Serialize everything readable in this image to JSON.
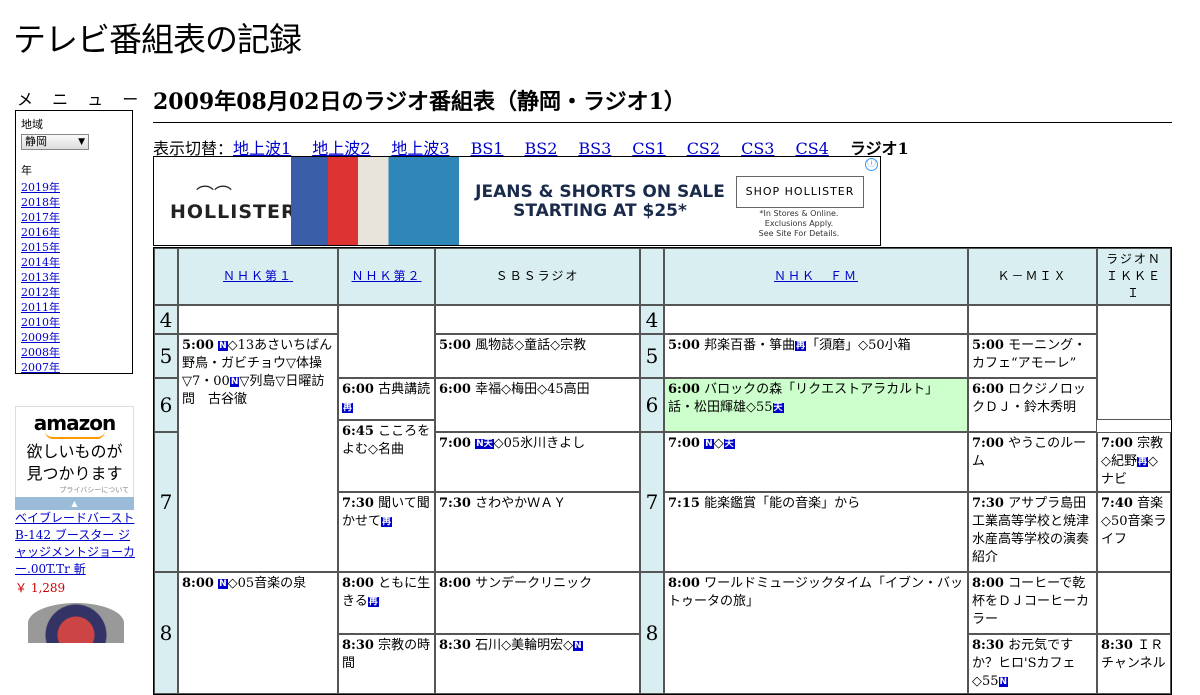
{
  "site": {
    "title": "テレビ番組表の記録"
  },
  "menu": {
    "heading": "メ ニ ュ ー",
    "region_label": "地域",
    "region_value": "静岡",
    "year_label": "年",
    "years": [
      "2019年",
      "2018年",
      "2017年",
      "2016年",
      "2015年",
      "2014年",
      "2013年",
      "2012年",
      "2011年",
      "2010年",
      "2009年",
      "2008年",
      "2007年"
    ]
  },
  "sidebar_ad": {
    "brand": "amazon",
    "message_line1": "欲しいものが",
    "message_line2": "見つかります",
    "privacy": "プライバシーについて",
    "product_title": "ベイブレードバースト B-142 ブースター ジャッジメントジョーカー.00T.Tr 斬",
    "product_price": "￥ 1,289"
  },
  "page": {
    "title": "2009年08月02日のラジオ番組表（静岡・ラジオ1）",
    "switch_label": "表示切替：",
    "switch_links": [
      "地上波1",
      "地上波2",
      "地上波3",
      "BS1",
      "BS2",
      "BS3",
      "CS1",
      "CS2",
      "CS3",
      "CS4"
    ],
    "switch_current": "ラジオ1"
  },
  "banner_ad": {
    "brand": "HOLLISTER",
    "headline_line1": "JEANS & SHORTS ON SALE",
    "headline_line2": "STARTING AT $25*",
    "button": "SHOP HOLLISTER",
    "fine1": "*In Stores & Online.",
    "fine2": "Exclusions Apply.",
    "fine3": "See Site For Details.",
    "info": "ⓘ"
  },
  "schedule": {
    "channels": [
      "ＮＨＫ第１",
      "ＮＨＫ第２",
      "ＳＢＳラジオ",
      "ＮＨＫ　ＦＭ",
      "Ｋ－ＭＩＸ",
      "ラジオＮＩＫＫＥＩ"
    ],
    "hours": [
      "4",
      "5",
      "6",
      "7",
      "8"
    ],
    "programs": {
      "nhk1_500": {
        "time": "5:00",
        "badge": "N",
        "text": "◇13あさいちばん　野鳥・ガビチョウ▽体操▽7・00",
        "badge2": "N",
        "text2": "▽列島▽日曜訪問　古谷徹"
      },
      "nhk1_800": {
        "time": "8:00",
        "badge": "N",
        "text": "◇05音楽の泉"
      },
      "nhk2_600": {
        "time": "6:00",
        "text": "古典講読",
        "badge": "再"
      },
      "nhk2_645": {
        "time": "6:45",
        "text": "こころをよむ◇名曲"
      },
      "nhk2_730": {
        "time": "7:30",
        "text": "聞いて聞かせて",
        "badge": "再"
      },
      "nhk2_800": {
        "time": "8:00",
        "text": "ともに生きる",
        "badge": "再"
      },
      "nhk2_830": {
        "time": "8:30",
        "text": "宗教の時間"
      },
      "sbs_500": {
        "time": "5:00",
        "text": "風物誌◇童話◇宗教"
      },
      "sbs_600": {
        "time": "6:00",
        "text": "幸福◇梅田◇45高田"
      },
      "sbs_700": {
        "time": "7:00",
        "badge": "N天",
        "text": "◇05氷川きよし"
      },
      "sbs_730": {
        "time": "7:30",
        "text": "さわやかＷＡＹ"
      },
      "sbs_800": {
        "time": "8:00",
        "text": "サンデークリニック"
      },
      "sbs_830": {
        "time": "8:30",
        "text": "石川◇美輪明宏◇",
        "badge": "N"
      },
      "fm_500": {
        "time": "5:00",
        "text": "邦楽百番・箏曲",
        "badge": "再",
        "text2": "「須磨」◇50小箱"
      },
      "fm_600": {
        "time": "6:00",
        "text": "バロックの森「リクエストアラカルト」話・松田輝雄◇55",
        "badge": "天"
      },
      "fm_700": {
        "time": "7:00",
        "badge": "N",
        "text": "◇",
        "badge2": "天"
      },
      "fm_715": {
        "time": "7:15",
        "text": "能楽鑑賞「能の音楽」から"
      },
      "fm_800": {
        "time": "8:00",
        "text": "ワールドミュージックタイム「イブン・バットゥータの旅」"
      },
      "kmix_500": {
        "time": "5:00",
        "text": "モーニング・カフェ“アモーレ”"
      },
      "kmix_600": {
        "time": "6:00",
        "text": "ロクジノロックＤＪ・鈴木秀明"
      },
      "kmix_700": {
        "time": "7:00",
        "text": "やうこのルーム"
      },
      "kmix_730": {
        "time": "7:30",
        "text": "アサプラ島田工業高等学校と焼津水産高等学校の演奏紹介"
      },
      "kmix_800": {
        "time": "8:00",
        "text": "コーヒーで乾杯をＤＪコーヒーカラー"
      },
      "kmix_830": {
        "time": "8:30",
        "text": "お元気ですか？ヒロ'Sカフェ◇55",
        "badge": "N"
      },
      "nikkei_700": {
        "time": "7:00",
        "text": "宗教◇紀野",
        "badge": "再",
        "text2": "◇ナビ"
      },
      "nikkei_740": {
        "time": "7:40",
        "text": "音楽◇50音楽ライフ"
      },
      "nikkei_830": {
        "time": "8:30",
        "text": "ＩＲチャンネル"
      }
    }
  }
}
